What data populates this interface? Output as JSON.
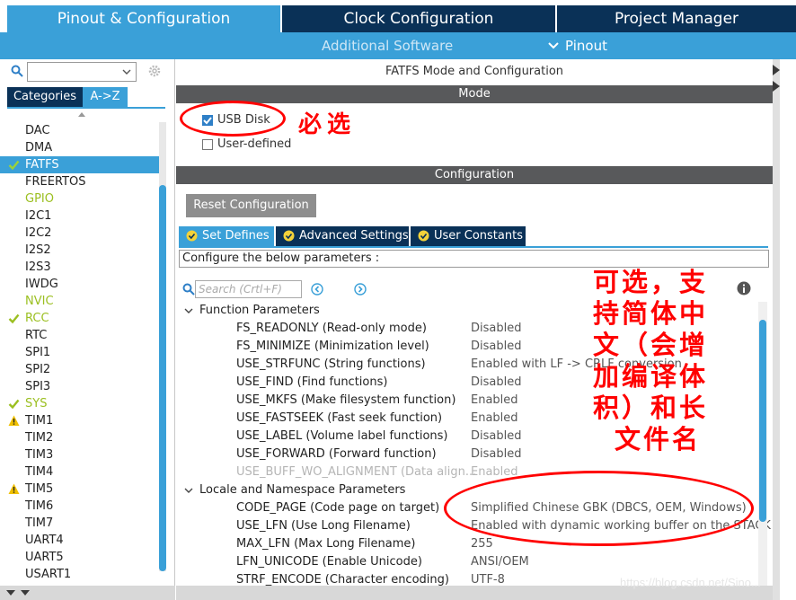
{
  "top_tabs": [
    {
      "label": "Pinout & Configuration"
    },
    {
      "label": "Clock Configuration"
    },
    {
      "label": "Project Manager"
    }
  ],
  "sub_nav": {
    "additional_software": "Additional Software",
    "pinout": "Pinout"
  },
  "left_panel": {
    "categories_tab": "Categories",
    "az_tab": "A->Z",
    "items": [
      {
        "label": "DAC",
        "status": "none"
      },
      {
        "label": "DMA",
        "status": "none"
      },
      {
        "label": "FATFS",
        "status": "checked",
        "selected": true
      },
      {
        "label": "FREERTOS",
        "status": "none"
      },
      {
        "label": "GPIO",
        "status": "green"
      },
      {
        "label": "I2C1",
        "status": "none"
      },
      {
        "label": "I2C2",
        "status": "none"
      },
      {
        "label": "I2S2",
        "status": "none"
      },
      {
        "label": "I2S3",
        "status": "none"
      },
      {
        "label": "IWDG",
        "status": "none"
      },
      {
        "label": "NVIC",
        "status": "green"
      },
      {
        "label": "RCC",
        "status": "checked-green"
      },
      {
        "label": "RTC",
        "status": "none"
      },
      {
        "label": "SPI1",
        "status": "none"
      },
      {
        "label": "SPI2",
        "status": "none"
      },
      {
        "label": "SPI3",
        "status": "none"
      },
      {
        "label": "SYS",
        "status": "checked-green"
      },
      {
        "label": "TIM1",
        "status": "warning"
      },
      {
        "label": "TIM2",
        "status": "none"
      },
      {
        "label": "TIM3",
        "status": "none"
      },
      {
        "label": "TIM4",
        "status": "none"
      },
      {
        "label": "TIM5",
        "status": "warning"
      },
      {
        "label": "TIM6",
        "status": "none"
      },
      {
        "label": "TIM7",
        "status": "none"
      },
      {
        "label": "UART4",
        "status": "none"
      },
      {
        "label": "UART5",
        "status": "none"
      },
      {
        "label": "USART1",
        "status": "none"
      }
    ]
  },
  "right_panel": {
    "title": "FATFS Mode and Configuration",
    "mode_header": "Mode",
    "mode_options": [
      {
        "label": "USB Disk",
        "checked": true
      },
      {
        "label": "User-defined",
        "checked": false
      }
    ],
    "config_header": "Configuration",
    "reset_button": "Reset Configuration",
    "tabs": [
      {
        "label": "Set Defines"
      },
      {
        "label": "Advanced Settings"
      },
      {
        "label": "User Constants"
      }
    ],
    "configure_text": "Configure the below parameters :",
    "search_placeholder": "Search (Crtl+F)",
    "groups": [
      {
        "name": "Function Parameters",
        "params": [
          {
            "name": "FS_READONLY (Read-only mode)",
            "value": "Disabled"
          },
          {
            "name": "FS_MINIMIZE (Minimization level)",
            "value": "Disabled"
          },
          {
            "name": "USE_STRFUNC (String functions)",
            "value": "Enabled with LF -> CRLF conversion"
          },
          {
            "name": "USE_FIND (Find functions)",
            "value": "Disabled"
          },
          {
            "name": "USE_MKFS (Make filesystem function)",
            "value": "Enabled"
          },
          {
            "name": "USE_FASTSEEK (Fast seek function)",
            "value": "Enabled"
          },
          {
            "name": "USE_LABEL (Volume label functions)",
            "value": "Disabled"
          },
          {
            "name": "USE_FORWARD (Forward function)",
            "value": "Disabled"
          },
          {
            "name": "USE_BUFF_WO_ALIGNMENT (Data align...",
            "value": "Enabled",
            "dim": true
          }
        ]
      },
      {
        "name": "Locale and Namespace Parameters",
        "params": [
          {
            "name": "CODE_PAGE (Code page on target)",
            "value": "Simplified Chinese GBK (DBCS, OEM, Windows)"
          },
          {
            "name": "USE_LFN (Use Long Filename)",
            "value": "Enabled with dynamic working buffer on the STACK"
          },
          {
            "name": "MAX_LFN (Max Long Filename)",
            "value": "255"
          },
          {
            "name": "LFN_UNICODE (Enable Unicode)",
            "value": "ANSI/OEM"
          },
          {
            "name": "STRF_ENCODE (Character encoding)",
            "value": "UTF-8"
          }
        ]
      }
    ]
  },
  "annotations": {
    "required": "必选",
    "optional_lines": [
      "可选，支",
      "持简体中",
      "文（会增",
      "加编译体",
      "积）和长",
      "文件名"
    ]
  },
  "watermark": "https://blog.csdn.net/Sino...",
  "colors": {
    "accent": "#3aa0d8",
    "dark_tab": "#0a3157",
    "section_bar": "#58595b",
    "annotation": "#ff0000",
    "ok_green": "#9bbf20",
    "warning": "#f0c000"
  }
}
